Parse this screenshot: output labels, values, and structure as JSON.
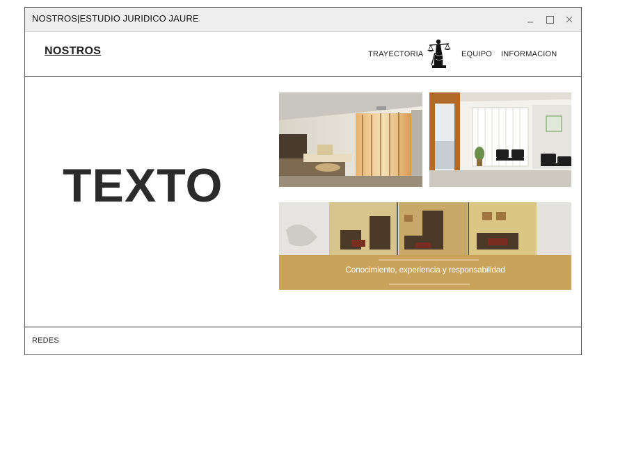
{
  "window": {
    "title": "NOSTROS|ESTUDIO JURIDICO JAURE",
    "controls": [
      "minimize-icon",
      "maximize-icon",
      "close-icon"
    ]
  },
  "header": {
    "brand": "NOSTROS",
    "nav": {
      "trayectoria": "TRAYECTORIA",
      "equipo": "EQUIPO",
      "informacion": "INFORMACION"
    },
    "logo_icon": "lady-justice-icon"
  },
  "main": {
    "hero_text": "TEXTO",
    "banner_caption": "Conocimiento, experiencia y responsabilidad"
  },
  "footer": {
    "redes": "REDES"
  },
  "colors": {
    "titlebar": "#eeeeee",
    "banner_gold": "#c9a25c",
    "border": "#333333"
  }
}
